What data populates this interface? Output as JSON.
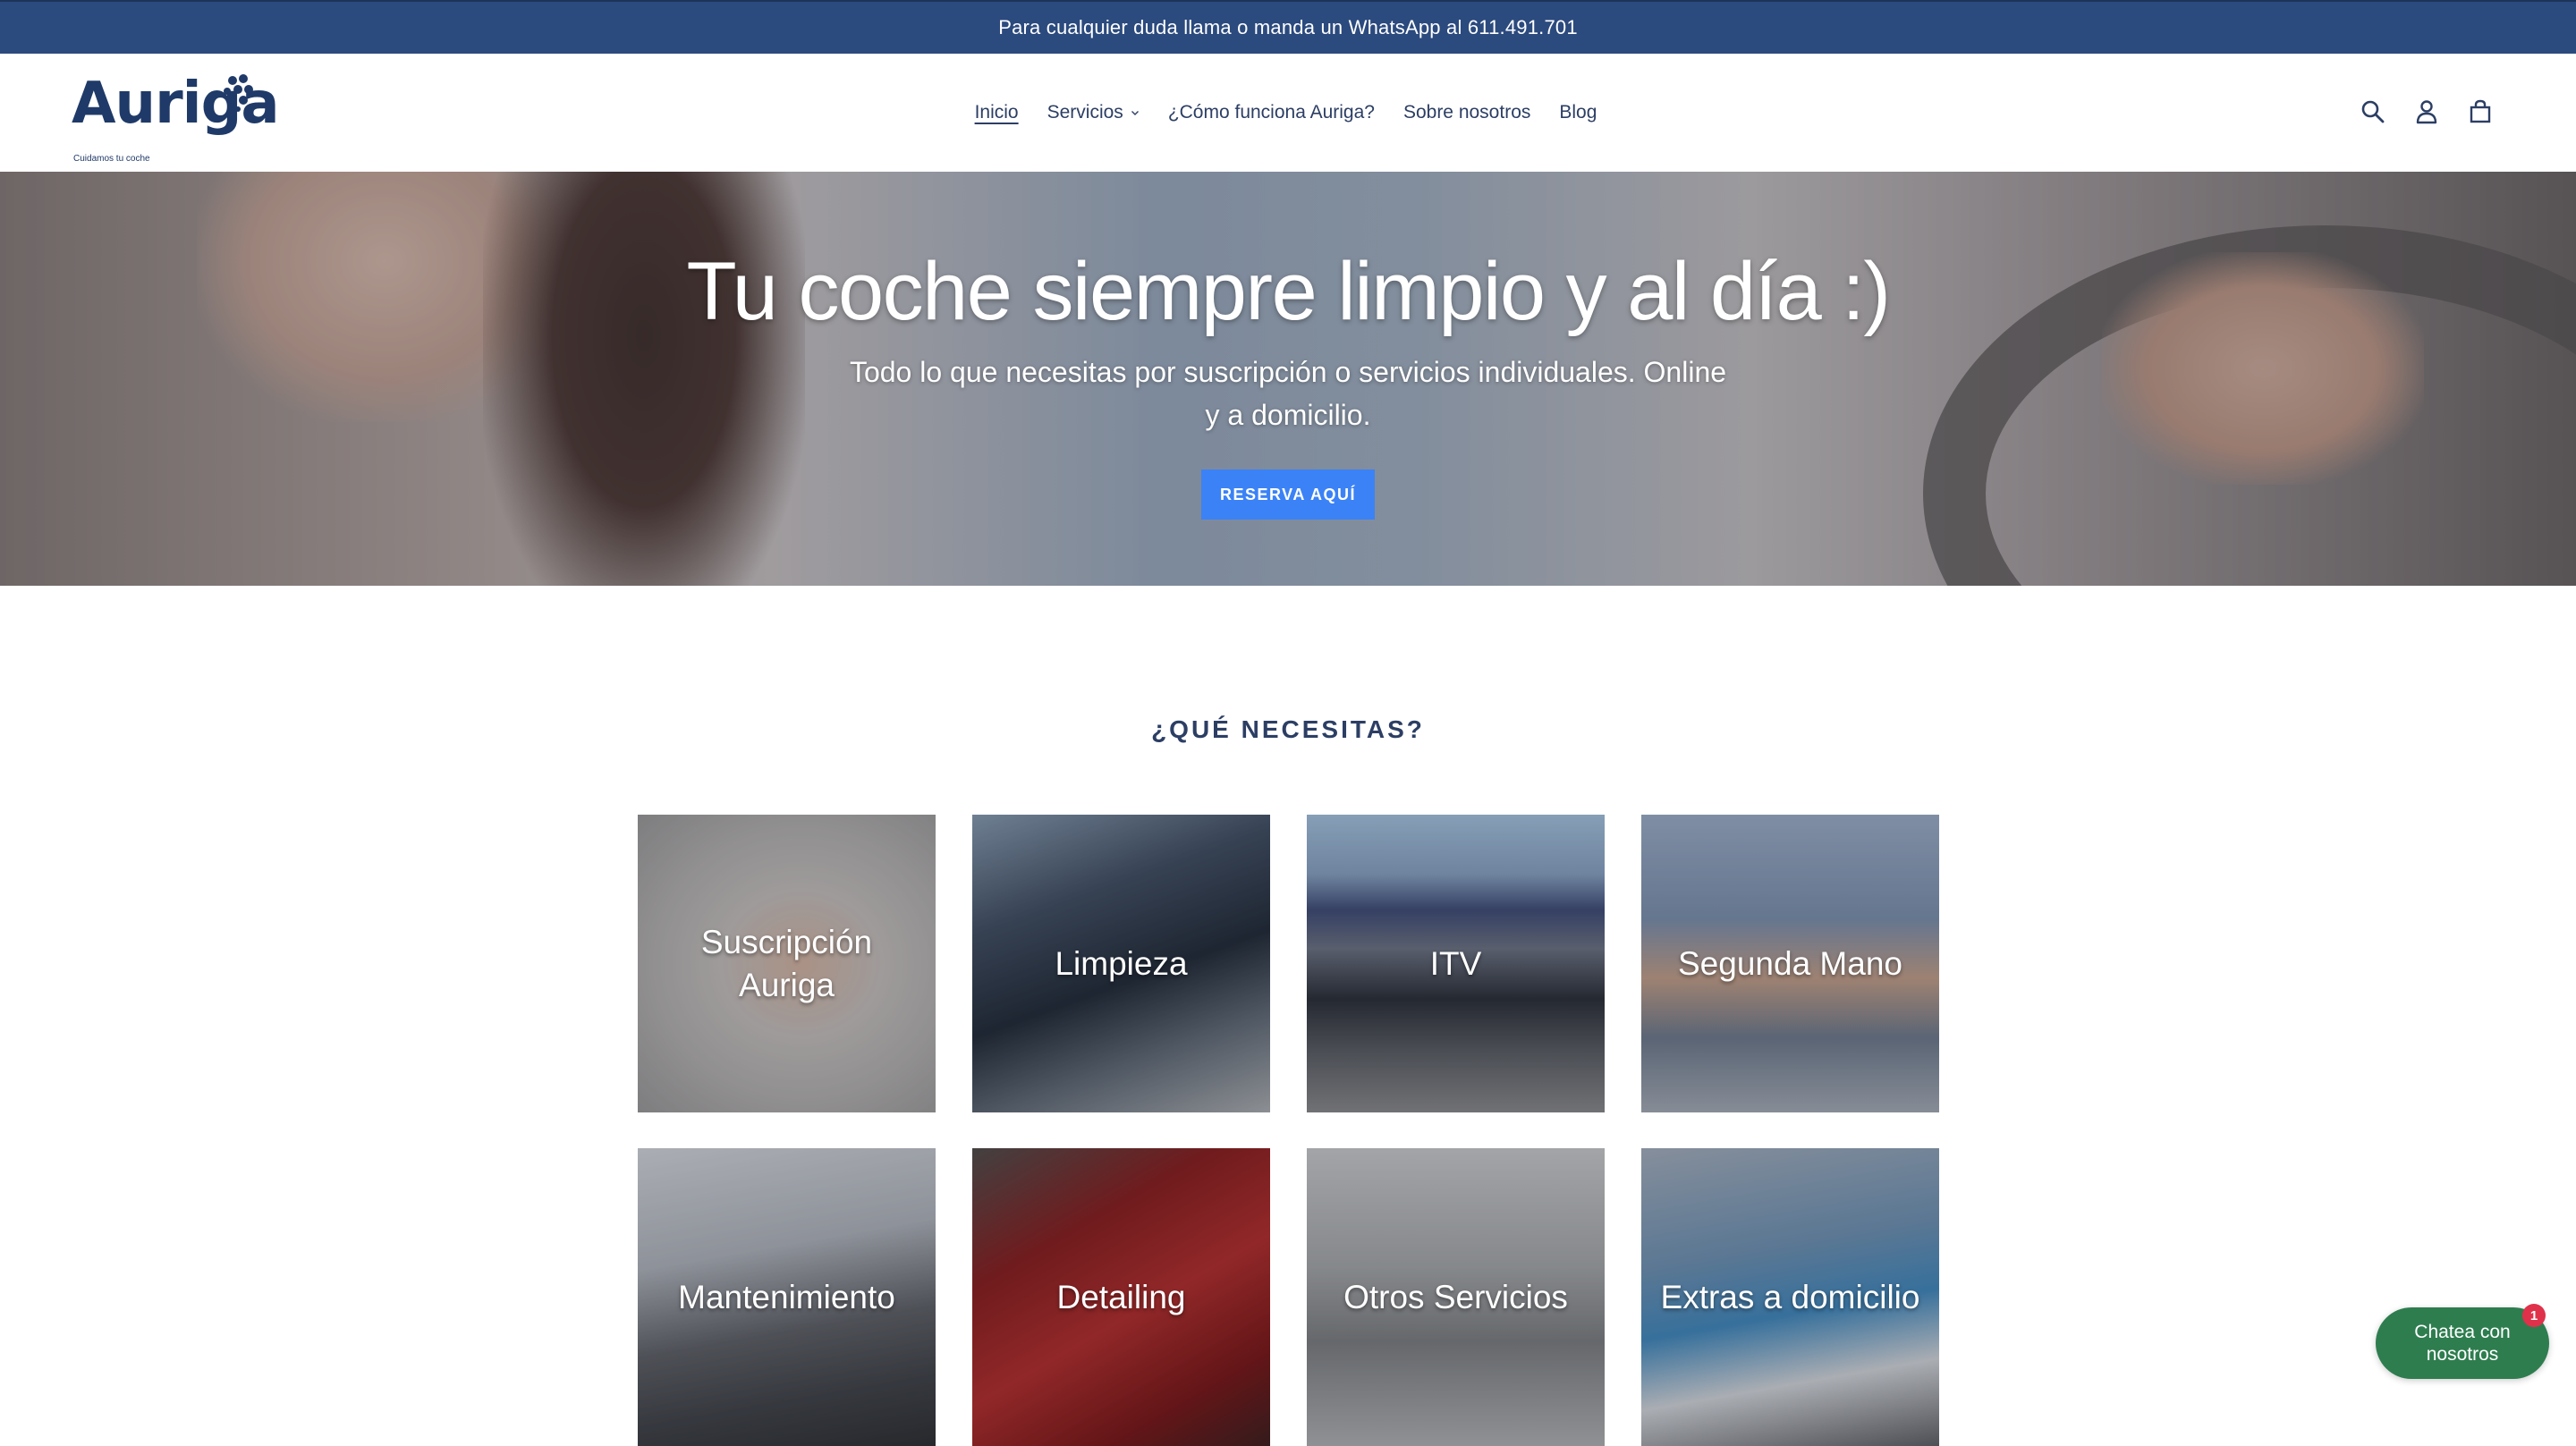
{
  "announcement": {
    "text": "Para cualquier duda llama o manda un WhatsApp al 611.491.701"
  },
  "logo": {
    "name": "Auriga",
    "tagline": "Cuidamos tu coche"
  },
  "nav": {
    "items": [
      {
        "label": "Inicio",
        "active": true
      },
      {
        "label": "Servicios",
        "dropdown": true
      },
      {
        "label": "¿Cómo funciona Auriga?"
      },
      {
        "label": "Sobre nosotros"
      },
      {
        "label": "Blog"
      }
    ]
  },
  "header_icons": [
    "search-icon",
    "account-icon",
    "cart-icon"
  ],
  "hero": {
    "title": "Tu coche siempre limpio y al día :)",
    "subtitle": "Todo lo que necesitas por suscripción o servicios individuales. Online y a domicilio.",
    "cta_label": "RESERVA AQUÍ"
  },
  "section": {
    "title": "¿QUÉ NECESITAS?",
    "cards": [
      {
        "label": "Suscripción Auriga"
      },
      {
        "label": "Limpieza"
      },
      {
        "label": "ITV"
      },
      {
        "label": "Segunda Mano"
      },
      {
        "label": "Mantenimiento"
      },
      {
        "label": "Detailing"
      },
      {
        "label": "Otros Servicios"
      },
      {
        "label": "Extras a domicilio"
      }
    ]
  },
  "chat": {
    "label": "Chatea con nosotros",
    "badge": "1"
  },
  "colors": {
    "announce_bg": "#2b4a7e",
    "brand": "#1f3a68",
    "cta": "#3b82f6",
    "chat": "#2e7d4f",
    "badge": "#e0314a"
  }
}
